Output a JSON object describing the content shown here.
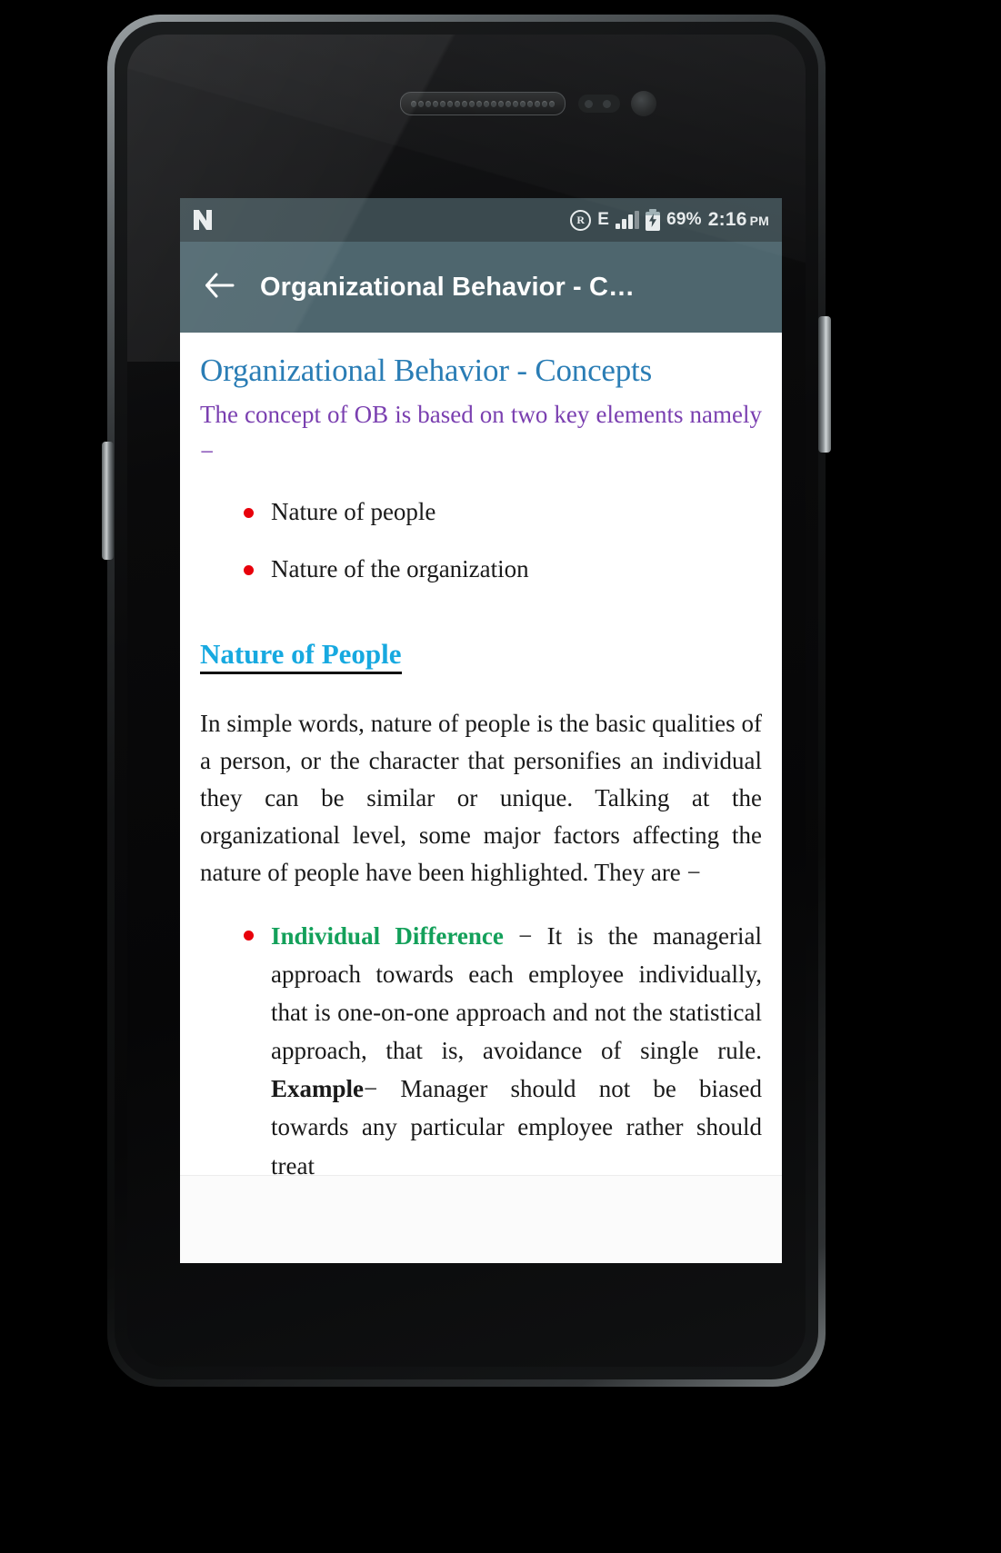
{
  "statusbar": {
    "os_logo": "android-n-logo",
    "registered_icon": "registered-trademark-icon",
    "network_type": "E",
    "signal_icon": "signal-bars-icon",
    "battery_icon": "battery-charging-icon",
    "battery_percent": "69%",
    "time": "2:16",
    "meridiem": "PM"
  },
  "appbar": {
    "back_icon": "back-arrow-icon",
    "title": "Organizational Behavior - C…"
  },
  "article": {
    "title": "Organizational Behavior - Concepts",
    "intro": "The concept of OB is based on two key elements namely −",
    "key_elements": [
      "Nature of people",
      "Nature of the organization"
    ],
    "section_link": "Nature of People",
    "section_paragraph": "In simple words, nature of people is the basic qualities of a person, or the character that personifies an individual they can be similar or unique. Talking at the organizational level, some major factors affecting the nature of people have been highlighted. They are −",
    "factors": [
      {
        "term": "Individual Difference",
        "dash": " − ",
        "text_before_example": "It is the managerial approach towards each employee individually, that is one-on-one approach and not the statistical approach, that is, avoidance of single rule. ",
        "example_label": "Example",
        "example_dash": "− ",
        "example_text": "Manager should not be biased towards any particular employee rather should treat"
      }
    ]
  },
  "colors": {
    "statusbar_bg": "#3b4a4f",
    "appbar_bg": "#4e666e",
    "article_title": "#2a7db5",
    "intro_text": "#7a3fb0",
    "bullet": "#e8000b",
    "link": "#17a9e0",
    "term_green": "#13a05a",
    "body_text": "#1a1a1a"
  }
}
